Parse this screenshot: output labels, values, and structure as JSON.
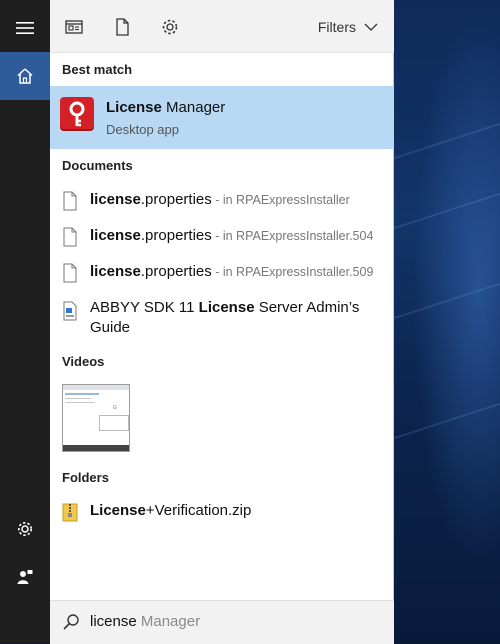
{
  "toolbar": {
    "filters_label": "Filters"
  },
  "best_match": {
    "heading": "Best match",
    "title_bold": "License",
    "title_rest": " Manager",
    "subtitle": "Desktop app"
  },
  "documents": {
    "heading": "Documents",
    "items": [
      {
        "bold": "license",
        "rest": ".properties",
        "location": " - in RPAExpressInstaller"
      },
      {
        "bold": "license",
        "rest": ".properties",
        "location": " - in RPAExpressInstaller.504"
      },
      {
        "bold": "license",
        "rest": ".properties",
        "location": " - in RPAExpressInstaller.509"
      }
    ],
    "guide": {
      "pre": "ABBYY SDK 11 ",
      "bold": "License",
      "post": " Server Admin’s Guide"
    }
  },
  "videos": {
    "heading": "Videos"
  },
  "folders": {
    "heading": "Folders",
    "items": [
      {
        "bold": "License",
        "rest": "+Verification.zip"
      }
    ]
  },
  "search": {
    "typed": "license",
    "suggestion": " Manager"
  },
  "colors": {
    "selection": "#b9d8f3",
    "rail_active": "#2e5b9a",
    "app_icon": "#d42127"
  }
}
